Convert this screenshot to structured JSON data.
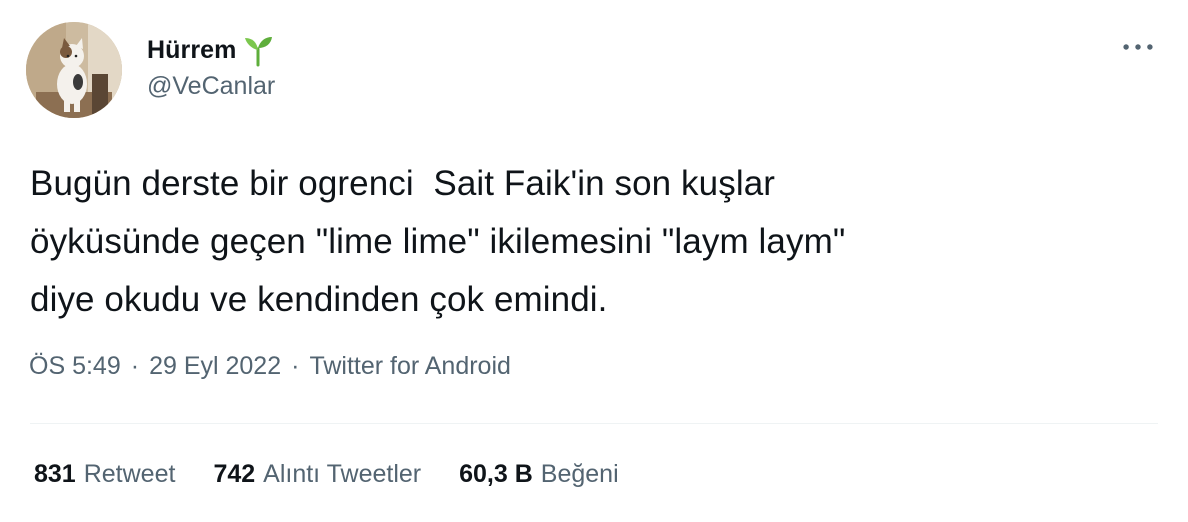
{
  "author": {
    "display_name": "Hürrem",
    "handle": "@VeCanlar",
    "badge_icon": "sprout-emoji",
    "avatar_icon": "cat-photo"
  },
  "more_icon": "more-dots-icon",
  "tweet": {
    "text": "Bugün derste bir ogrenci  Sait Faik'in son kuşlar\nöyküsünde geçen \"lime lime\" ikilemesini \"laym laym\"\ndiye okudu ve kendinden çok emindi."
  },
  "meta": {
    "time": "ÖS 5:49",
    "separator": "·",
    "date": "29 Eyl 2022",
    "source": "Twitter for Android"
  },
  "stats": {
    "retweets": {
      "count": "831",
      "label": "Retweet"
    },
    "quotes": {
      "count": "742",
      "label": "Alıntı Tweetler"
    },
    "likes": {
      "count": "60,3 B",
      "label": "Beğeni"
    }
  },
  "colors": {
    "text": "#0f1419",
    "secondary": "#536471",
    "divider": "#eff3f4",
    "sprout_green": "#5eae3b"
  }
}
